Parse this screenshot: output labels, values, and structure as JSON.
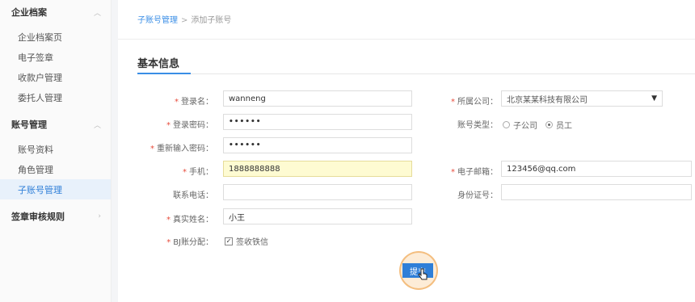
{
  "sidebar": {
    "sections": [
      {
        "title": "企业档案",
        "items": [
          "企业档案页",
          "电子签章",
          "收款户管理",
          "委托人管理"
        ]
      },
      {
        "title": "账号管理",
        "items": [
          "账号资料",
          "角色管理",
          "子账号管理"
        ]
      },
      {
        "title": "签章审核规则",
        "items": []
      }
    ],
    "active_item": "子账号管理",
    "chevron_icons": [
      "chevron-up-icon",
      "chevron-up-icon",
      "chevron-right-icon"
    ]
  },
  "breadcrumb": {
    "parent": "子账号管理",
    "separator": ">",
    "current": "添加子账号"
  },
  "section_title": "基本信息",
  "form": {
    "username": {
      "label": "登录名：",
      "value": "wanneng"
    },
    "password": {
      "label": "登录密码：",
      "value": "••••••"
    },
    "confirm_password": {
      "label": "重新输入密码：",
      "value": "••••••"
    },
    "phone": {
      "label": "手机：",
      "value": "1888888888"
    },
    "contact_phone": {
      "label": "联系电话：",
      "value": ""
    },
    "real_name": {
      "label": "真实姓名：",
      "value": "小王"
    },
    "bj_assign": {
      "label": "BJ账分配：",
      "option": "签收铁信",
      "checked": true
    },
    "company": {
      "label": "所属公司：",
      "value": "北京某某科技有限公司"
    },
    "account_type": {
      "label": "账号类型：",
      "options": [
        "子公司",
        "员工"
      ],
      "selected": "员工"
    },
    "email": {
      "label": "电子邮箱：",
      "value": "123456@qq.com"
    },
    "id_number": {
      "label": "身份证号：",
      "value": ""
    }
  },
  "submit_label": "提交",
  "colors": {
    "accent": "#2f7fd8",
    "required": "#e74c3c",
    "highlight_field": "#fefbd2",
    "click_ring": "#f0aa5a"
  }
}
